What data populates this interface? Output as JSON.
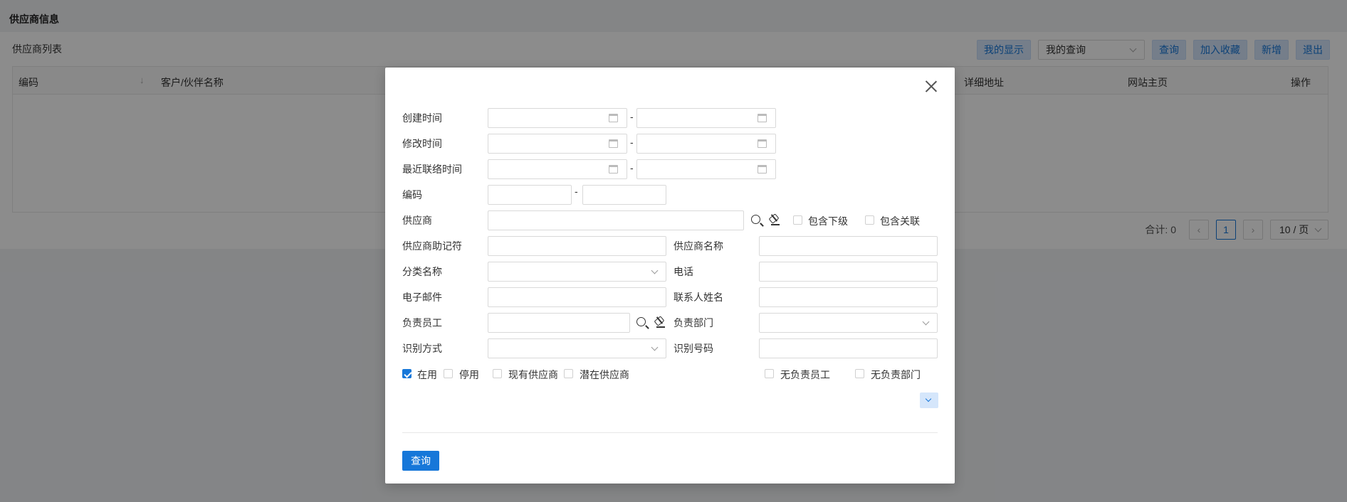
{
  "page": {
    "title": "供应商信息"
  },
  "list": {
    "title": "供应商列表",
    "toolbar": {
      "my_display": "我的显示",
      "my_query_select": "我的查询",
      "query": "查询",
      "add_favorite": "加入收藏",
      "add_new": "新增",
      "exit": "退出"
    },
    "columns": {
      "code": "编码",
      "partner_name": "客户/伙伴名称",
      "address": "详细地址",
      "website": "网站主页",
      "actions": "操作"
    },
    "pager": {
      "total": "合计: 0",
      "current_page": "1",
      "page_size": "10 / 页"
    }
  },
  "modal": {
    "labels": {
      "created_time": "创建时间",
      "modified_time": "修改时间",
      "last_contact_time": "最近联络时间",
      "code": "编码",
      "supplier": "供应商",
      "supplier_mnemonic": "供应商助记符",
      "supplier_name": "供应商名称",
      "category_name": "分类名称",
      "phone": "电话",
      "email": "电子邮件",
      "contact_name": "联系人姓名",
      "responsible_employee": "负责员工",
      "responsible_department": "负责部门",
      "identification_method": "识别方式",
      "identification_number": "识别号码"
    },
    "range_separator": "-",
    "checkboxes": {
      "include_sub": {
        "label": "包含下级",
        "checked": false
      },
      "include_related": {
        "label": "包含关联",
        "checked": false
      },
      "active": {
        "label": "在用",
        "checked": true
      },
      "disabled": {
        "label": "停用",
        "checked": false
      },
      "existing_supplier": {
        "label": "现有供应商",
        "checked": false
      },
      "potential_supplier": {
        "label": "潜在供应商",
        "checked": false
      },
      "no_employee": {
        "label": "无负责员工",
        "checked": false
      },
      "no_department": {
        "label": "无负责部门",
        "checked": false
      }
    },
    "submit_label": "查询"
  },
  "colors": {
    "primary": "#1677d9",
    "primary_light": "#d5e6fb",
    "overlay": "rgba(0,0,0,0.45)"
  }
}
